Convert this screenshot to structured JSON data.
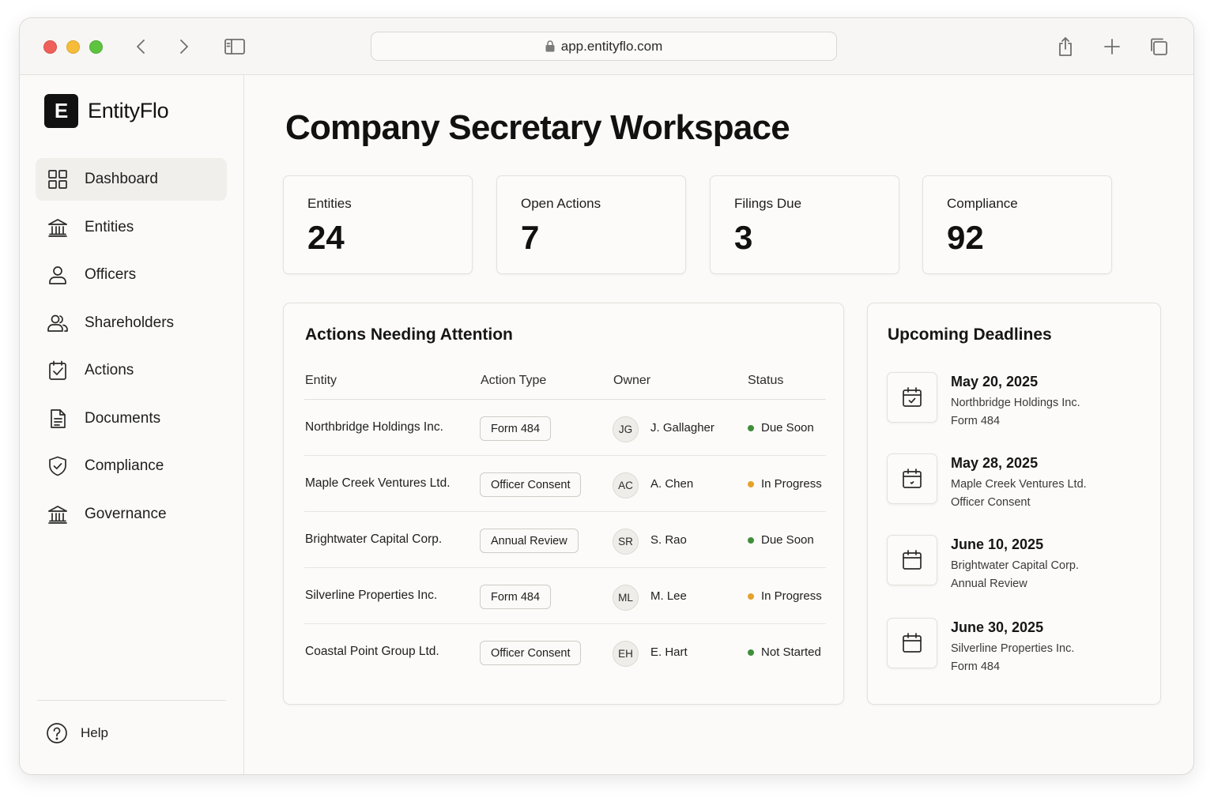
{
  "browser": {
    "url": "app.entityflo.com"
  },
  "brand": {
    "logo_letter": "E",
    "name": "EntityFlo"
  },
  "sidebar": {
    "items": [
      {
        "label": "Dashboard",
        "icon": "grid-icon",
        "active": true
      },
      {
        "label": "Entities",
        "icon": "building-icon",
        "active": false
      },
      {
        "label": "Officers",
        "icon": "person-icon",
        "active": false
      },
      {
        "label": "Shareholders",
        "icon": "people-icon",
        "active": false
      },
      {
        "label": "Actions",
        "icon": "checklist-icon",
        "active": false
      },
      {
        "label": "Documents",
        "icon": "document-icon",
        "active": false
      },
      {
        "label": "Compliance",
        "icon": "shield-check-icon",
        "active": false
      },
      {
        "label": "Governance",
        "icon": "institution-icon",
        "active": false
      }
    ],
    "help_label": "Help"
  },
  "main": {
    "title": "Company Secretary Workspace",
    "stats": [
      {
        "label": "Entities",
        "value": "24"
      },
      {
        "label": "Open Actions",
        "value": "7"
      },
      {
        "label": "Filings Due",
        "value": "3"
      },
      {
        "label": "Compliance",
        "value": "92"
      }
    ]
  },
  "actions": {
    "title": "Actions Needing Attention",
    "columns": [
      "Entity",
      "Action Type",
      "Owner",
      "Status"
    ],
    "rows": [
      {
        "entity": "Northbridge Holdings Inc.",
        "action_type": "Form 484",
        "initials": "JG",
        "owner": "J. Gallagher",
        "status": "Due Soon",
        "status_color": "#3f8f3a"
      },
      {
        "entity": "Maple Creek Ventures Ltd.",
        "action_type": "Officer Consent",
        "initials": "AC",
        "owner": "A. Chen",
        "status": "In Progress",
        "status_color": "#e6a12b"
      },
      {
        "entity": "Brightwater Capital Corp.",
        "action_type": "Annual Review",
        "initials": "SR",
        "owner": "S. Rao",
        "status": "Due Soon",
        "status_color": "#3f8f3a"
      },
      {
        "entity": "Silverline Properties Inc.",
        "action_type": "Form 484",
        "initials": "ML",
        "owner": "M. Lee",
        "status": "In Progress",
        "status_color": "#e6a12b"
      },
      {
        "entity": "Coastal Point Group Ltd.",
        "action_type": "Officer Consent",
        "initials": "EH",
        "owner": "E. Hart",
        "status": "Not Started",
        "status_color": "#3f8f3a"
      }
    ]
  },
  "deadlines": {
    "title": "Upcoming Deadlines",
    "items": [
      {
        "date": "May 20, 2025",
        "entity": "Northbridge Holdings Inc.",
        "type": "Form 484",
        "icon": "calendar-check-icon"
      },
      {
        "date": "May 28, 2025",
        "entity": "Maple Creek Ventures Ltd.",
        "type": "Officer Consent",
        "icon": "calendar-check-icon"
      },
      {
        "date": "June 10, 2025",
        "entity": "Brightwater Capital Corp.",
        "type": "Annual Review",
        "icon": "calendar-icon"
      },
      {
        "date": "June 30, 2025",
        "entity": "Silverline Properties Inc.",
        "type": "Form 484",
        "icon": "calendar-icon"
      }
    ]
  }
}
